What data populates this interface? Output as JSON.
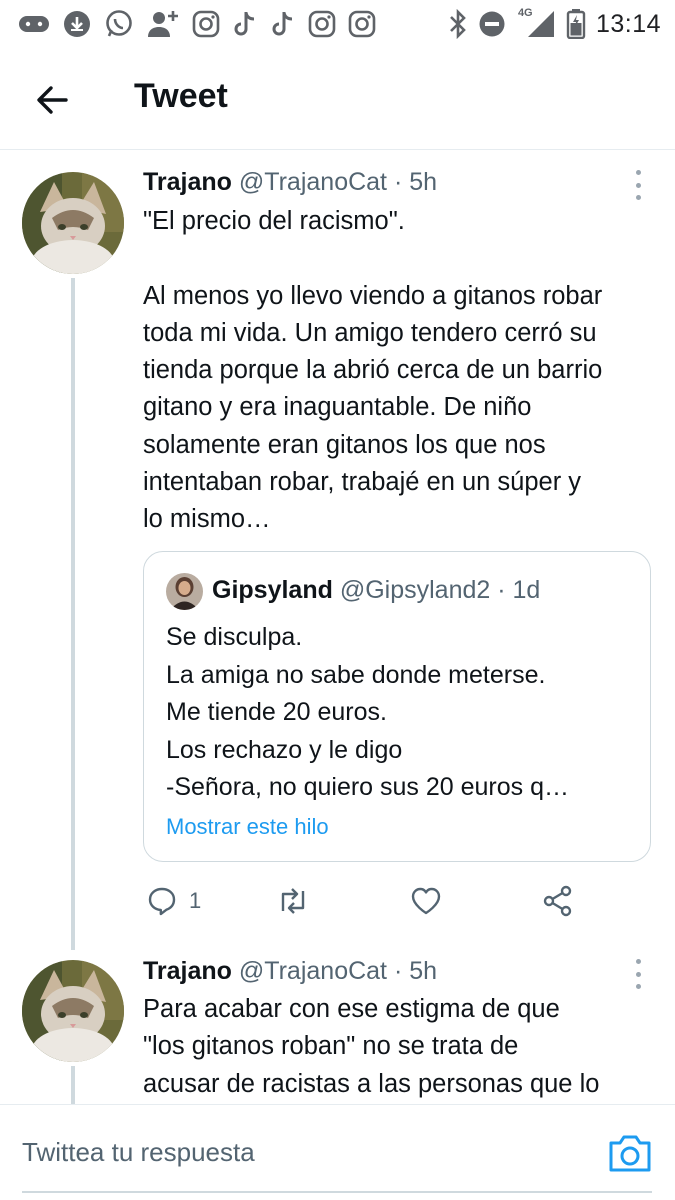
{
  "status_bar": {
    "time": "13:14",
    "network": "4G",
    "icons": [
      "gamepad-icon",
      "download-icon",
      "whatsapp-icon",
      "add-contact-icon",
      "instagram-icon",
      "tiktok-icon",
      "tiktok-icon",
      "instagram-icon",
      "instagram-icon",
      "bluetooth-icon",
      "do-not-disturb-icon",
      "signal-icon",
      "battery-icon"
    ]
  },
  "header": {
    "back_icon": "arrow-left-icon",
    "title": "Tweet"
  },
  "tweets": [
    {
      "name": "Trajano",
      "handle": "@TrajanoCat",
      "separator": "·",
      "time": "5h",
      "text": "\"El precio del racismo\".\n\nAl menos yo llevo viendo a gitanos robar\ntoda mi vida. Un amigo tendero cerró su\ntienda porque la abrió cerca de un barrio\ngitano y era inaguantable. De niño\nsolamente eran gitanos los que nos\nintentaban robar, trabajé en un súper y\nlo mismo…",
      "quote": {
        "name": "Gipsyland",
        "handle": "@Gipsyland2",
        "separator": "·",
        "time": "1d",
        "text": "Se disculpa.\nLa amiga no sabe donde meterse.\nMe tiende 20 euros.\nLos rechazo y le digo\n-Señora, no quiero sus 20 euros q…",
        "show_thread": "Mostrar este hilo"
      },
      "actions": {
        "reply_count": "1"
      }
    },
    {
      "name": "Trajano",
      "handle": "@TrajanoCat",
      "separator": "·",
      "time": "5h",
      "text": "Para acabar con ese estigma de que\n\"los gitanos roban\" no se trata de\nacusar de racistas a las personas que lo"
    }
  ],
  "reply_bar": {
    "placeholder": "Twittea tu respuesta",
    "camera_icon": "camera-icon"
  },
  "colors": {
    "accent": "#1d9bf0",
    "text": "#0f1419",
    "secondary": "#536471",
    "border": "#cfd9de"
  }
}
